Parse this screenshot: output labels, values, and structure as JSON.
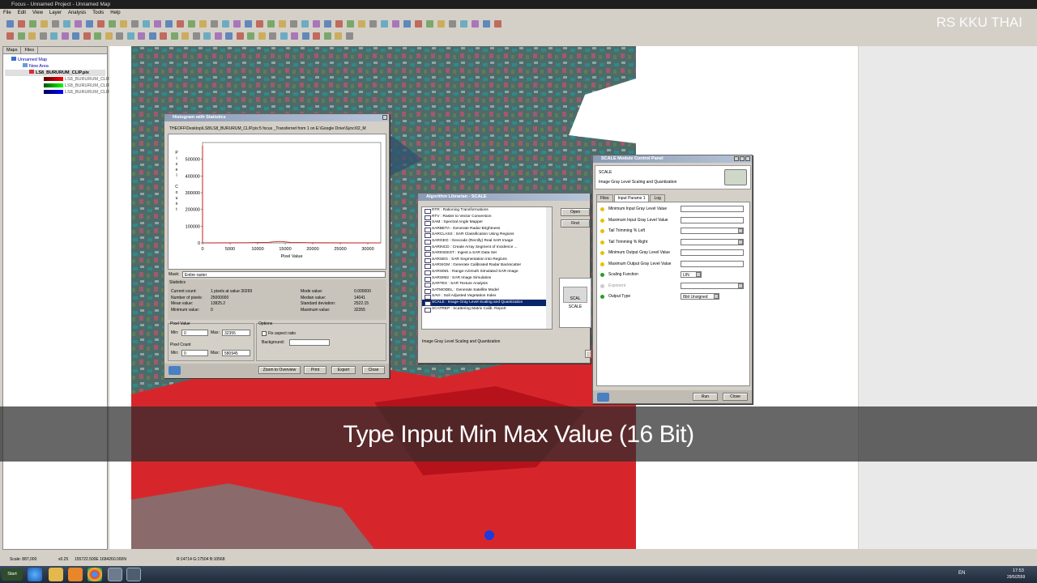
{
  "app": {
    "title": "Focus - Unnamed Project - Unnamed Map",
    "menus": [
      "File",
      "Edit",
      "View",
      "Layer",
      "Analysis",
      "Tools",
      "Help"
    ]
  },
  "watermark": "RS KKU THAI",
  "subtitle": "Type Input Min Max Value (16 Bit)",
  "left_panel": {
    "tabs": [
      "Maps",
      "Files"
    ],
    "tree": [
      "Unnamed Map",
      "New Area",
      "LS8_BURURUM_CLIP.pix",
      "LS8_BURURUM_CLIP",
      "LS8_BURURUM_CLIP",
      "LS8_BURURUM_CLIP"
    ]
  },
  "histogram": {
    "title": "Histogram with Statistics",
    "path": "THEOFF\\Desktop\\LS8\\LS8_BURURUM_CLIP.pix:5 focus _Transferred from 1 on E:\\Google Drive\\Sync\\02_M",
    "ylabel_chars": [
      "P",
      "i",
      "x",
      "e",
      "l",
      "",
      "C",
      "o",
      "u",
      "n",
      "t"
    ],
    "xlabel": "Pixel Value",
    "mask_label": "Mask:",
    "mask_value": "Entire raster",
    "statistics_label": "Statistics",
    "stats_left": [
      [
        "Current count:",
        "1 pixels at value 30269"
      ],
      [
        "Number of pixels:",
        "25000000"
      ],
      [
        "Mean value:",
        "13825.2"
      ],
      [
        "Minimum value:",
        "0"
      ]
    ],
    "stats_right": [
      [
        "Mode value:",
        "0.000000"
      ],
      [
        "Median value:",
        "14041"
      ],
      [
        "Standard deviation:",
        "2522.15"
      ],
      [
        "Maximum value:",
        "32355"
      ]
    ],
    "pixel_value_label": "Pixel Value",
    "min_label": "Min:",
    "max_label": "Max:",
    "pv_min": "0",
    "pv_max": "32355",
    "pixel_count_label": "Pixel Count",
    "pc_min": "0",
    "pc_max": "580945",
    "options_label": "Options",
    "fix_aspect": "Fix aspect ratio",
    "background_label": "Background:",
    "buttons": {
      "zoom": "Zoom to Overview",
      "print": "Print",
      "export": "Export",
      "close": "Close"
    }
  },
  "chart_data": {
    "type": "line",
    "title": "",
    "xlabel": "Pixel Value",
    "ylabel": "Pixel Count",
    "xlim": [
      0,
      32355
    ],
    "ylim": [
      0,
      600000
    ],
    "x_ticks": [
      0,
      5000,
      10000,
      15000,
      20000,
      25000,
      30000
    ],
    "y_ticks": [
      0,
      100000,
      200000,
      300000,
      400000,
      500000
    ],
    "x": [
      0,
      1,
      2000,
      8000,
      12000,
      14000,
      16000,
      20000,
      26000,
      32355
    ],
    "values": [
      580945,
      0,
      400,
      1200,
      3500,
      9000,
      3200,
      900,
      200,
      0
    ],
    "color": "#cc0000",
    "grid": false
  },
  "algo": {
    "title": "Algorithm Librarian - SCALE",
    "items": [
      "RTR : Rationing Transformations",
      "RTV : Raster to Vector Conversion",
      "SAM : Spectral Angle Mapper",
      "SARBETA : Generate Radar Brightness",
      "SARCLASS : SAR Classification Using Regions",
      "SARGEO : Geocode (Rectify) Real SAR Image",
      "SARINCD : Create Array Segment of Incidence ...",
      "SARINGEST : Ingest a SAR Data Set",
      "SARSEG : SAR Segmentation into Regions",
      "SARSIGM : Generate Calibrated Radar Backscatter",
      "SARSIM1 : Range-Azimuth Simulated SAR Image",
      "SARSIM2 : SAR Image Simulation",
      "SARTEX : SAR Texture Analysis",
      "SATMODEL : Generate Satellite Model",
      "SAVI : Soil Adjusted Vegetation Index",
      "SCALE : Image Gray Level Scaling and Quantization",
      "SCATREP : Scattering Matrix Calib. Report"
    ],
    "selected": 15,
    "status": "Image Gray Level Scaling and Quantization",
    "btn_open": "Open",
    "btn_find": "Find",
    "thumb_label": "SCALE",
    "thumb_icon": "SCAL"
  },
  "scale": {
    "title": "SCALE Module Control Panel",
    "name": "SCALE",
    "desc": "Image Gray Level Scaling and Quantization",
    "tabs": [
      "Files",
      "Input Params 1",
      "Log"
    ],
    "params": [
      {
        "label": "Minimum Input Gray Level Value",
        "color": "#e8c000",
        "type": "text",
        "value": ""
      },
      {
        "label": "Maximum Input Gray Level Value",
        "color": "#e8c000",
        "type": "text",
        "value": ""
      },
      {
        "label": "Tail Trimming % Left",
        "color": "#e8c000",
        "type": "select",
        "value": ""
      },
      {
        "label": "Tail Trimming % Right",
        "color": "#e8c000",
        "type": "select",
        "value": ""
      },
      {
        "label": "Minimum Output Gray Level Value",
        "color": "#e8c000",
        "type": "text",
        "value": ""
      },
      {
        "label": "Maximum Output Gray Level Value",
        "color": "#e8c000",
        "type": "text",
        "value": ""
      },
      {
        "label": "Scaling Function",
        "color": "#22a022",
        "type": "select",
        "value": "LIN"
      },
      {
        "label": "Exponent",
        "color": "#cccccc",
        "type": "select",
        "value": ""
      },
      {
        "label": "Output Type",
        "color": "#22a022",
        "type": "select",
        "value": "8bit Unsigned"
      }
    ],
    "btn_run": "Run",
    "btn_close": "Close"
  },
  "status": {
    "scale": "Scale: 887,000",
    "zoom": "x0.25",
    "coords": "155722.500E 1684260.000N",
    "rgb": "R:14714 G:17504 B:10568"
  },
  "taskbar": {
    "start": "Start",
    "lang": "EN",
    "time": "17:53",
    "date": "29/5/2559"
  }
}
